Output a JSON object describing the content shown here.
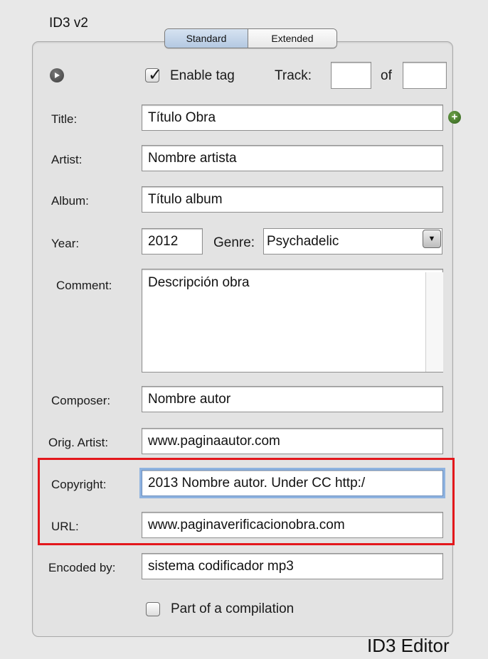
{
  "section_title": "ID3 v2",
  "tabs": [
    {
      "label": "Standard",
      "selected": true
    },
    {
      "label": "Extended",
      "selected": false
    }
  ],
  "tag": {
    "enable_label": "Enable tag",
    "enabled": true,
    "track_label": "Track:",
    "track_value": "",
    "of_label": "of",
    "of_value": ""
  },
  "fields": {
    "title": {
      "label": "Title:",
      "value": "Título Obra"
    },
    "artist": {
      "label": "Artist:",
      "value": "Nombre artista"
    },
    "album": {
      "label": "Album:",
      "value": "Título album"
    },
    "year": {
      "label": "Year:",
      "value": "2012"
    },
    "genre": {
      "label": "Genre:",
      "value": "Psychadelic"
    },
    "comment": {
      "label": "Comment:",
      "value": "Descripción obra"
    },
    "composer": {
      "label": "Composer:",
      "value": "Nombre autor"
    },
    "orig_artist": {
      "label": "Orig. Artist:",
      "value": "www.paginaautor.com"
    },
    "copyright": {
      "label": "Copyright:",
      "value": "2013 Nombre autor. Under CC http:/"
    },
    "url": {
      "label": "URL:",
      "value": "www.paginaverificacionobra.com"
    },
    "encoded_by": {
      "label": "Encoded by:",
      "value": "sistema codificador mp3"
    }
  },
  "compilation": {
    "label": "Part of a compilation",
    "checked": false
  },
  "caption": "ID3 Editor",
  "colors": {
    "highlight": "#e3171c",
    "selected_tab": "#c5d6ea",
    "add_button": "#3f7a2a"
  }
}
